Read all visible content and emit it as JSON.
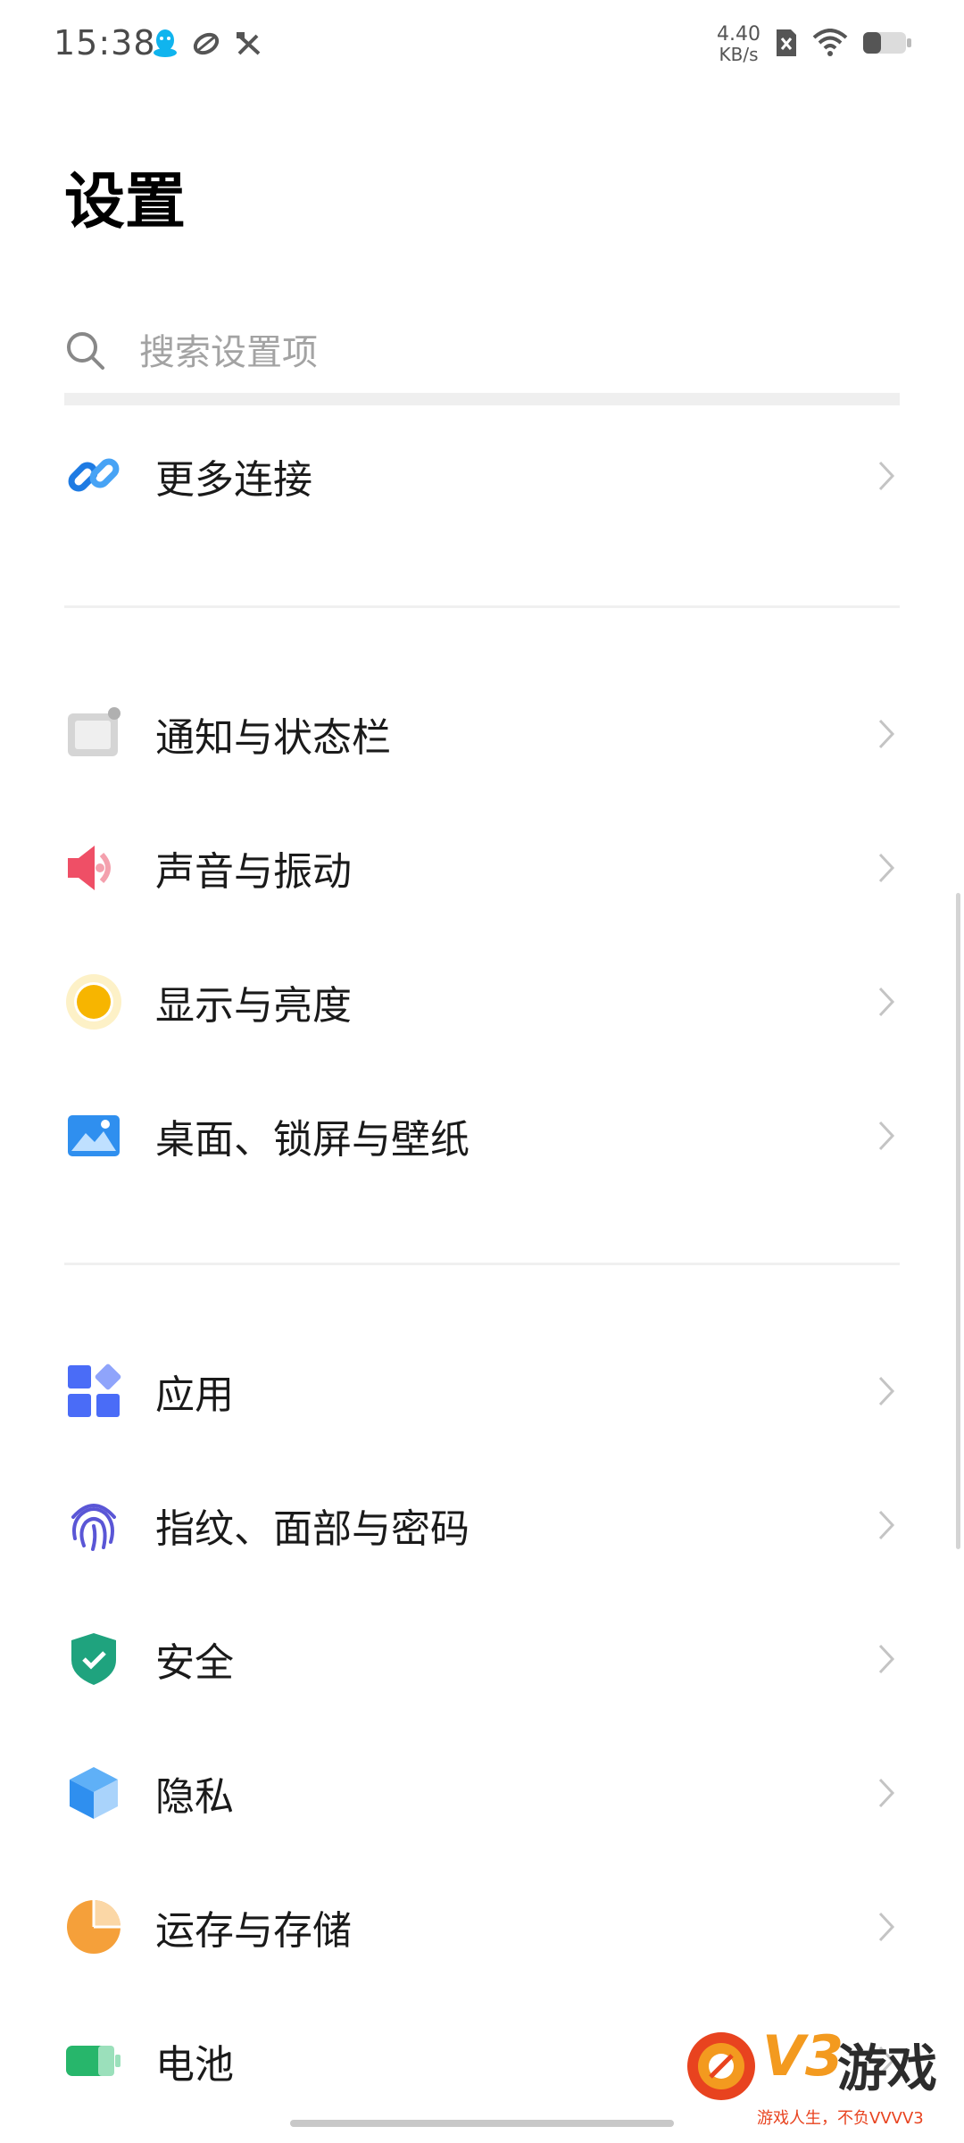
{
  "status_bar": {
    "time": "15:38",
    "left_icons": [
      "qq-icon",
      "sync-icon",
      "tools-icon"
    ],
    "net_speed_value": "4.40",
    "net_speed_unit": "KB/s",
    "right_icons": [
      "sim-off-icon",
      "wifi-icon",
      "battery-icon"
    ]
  },
  "page_title": "设置",
  "search": {
    "placeholder": "搜索设置项"
  },
  "groups": [
    {
      "items": [
        {
          "label": "更多连接",
          "icon": "link-icon",
          "color": "#1e7be3"
        }
      ]
    },
    {
      "items": [
        {
          "label": "通知与状态栏",
          "icon": "notification-icon",
          "color": "#b9b9b9"
        },
        {
          "label": "声音与振动",
          "icon": "speaker-icon",
          "color": "#ef4f66"
        },
        {
          "label": "显示与亮度",
          "icon": "brightness-icon",
          "color": "#f7b500"
        },
        {
          "label": "桌面、锁屏与壁纸",
          "icon": "wallpaper-icon",
          "color": "#2f8fef"
        }
      ]
    },
    {
      "items": [
        {
          "label": "应用",
          "icon": "apps-icon",
          "color": "#4a6cf7"
        },
        {
          "label": "指纹、面部与密码",
          "icon": "fingerprint-icon",
          "color": "#5a56d6"
        },
        {
          "label": "安全",
          "icon": "shield-icon",
          "color": "#1fa37e"
        },
        {
          "label": "隐私",
          "icon": "privacy-cube-icon",
          "color": "#2f8fef"
        },
        {
          "label": "运存与存储",
          "icon": "storage-pie-icon",
          "color": "#f5a03a"
        },
        {
          "label": "电池",
          "icon": "battery-icon",
          "color": "#27b66b"
        }
      ]
    }
  ],
  "watermark": {
    "logo": "V3",
    "title": "游戏",
    "tagline": "游戏人生，不负VVVV3"
  }
}
